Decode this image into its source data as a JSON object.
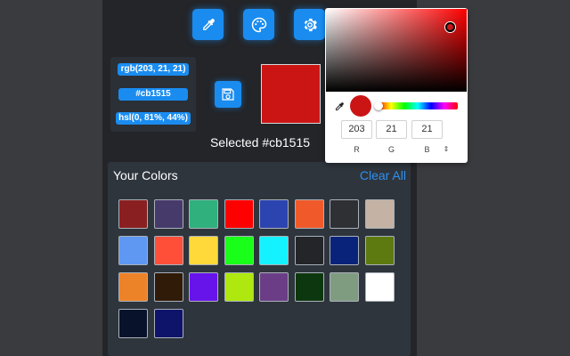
{
  "toolbar": {
    "icons": [
      "eyedropper-icon",
      "palette-icon",
      "gear-icon"
    ]
  },
  "formats": {
    "rgb": "rgb(203, 21, 21)",
    "hex": "#cb1515",
    "hsl": "hsl(0, 81%, 44%)"
  },
  "selected": {
    "color": "#cb1515",
    "label": "Selected #cb1515"
  },
  "your_colors": {
    "title": "Your Colors",
    "clear_label": "Clear All",
    "swatches": [
      "#8a1f21",
      "#463a6b",
      "#2fb07d",
      "#ff0000",
      "#2c44b0",
      "#f05a2b",
      "#2e3034",
      "#c4b2a4",
      "#5e98f2",
      "#ff4f39",
      "#ffd939",
      "#19ff19",
      "#14f2ff",
      "#232529",
      "#0a237a",
      "#5c7a10",
      "#ed8329",
      "#301a08",
      "#6714eb",
      "#aee80f",
      "#6b3d87",
      "#0d380f",
      "#7f9c81",
      "#ffffff",
      "#08122b",
      "#0f146b"
    ]
  },
  "picker": {
    "hue_color": "#ff0000",
    "r": "203",
    "g": "21",
    "b": "21",
    "r_label": "R",
    "g_label": "G",
    "b_label": "B",
    "mode_toggle": "⇕"
  }
}
